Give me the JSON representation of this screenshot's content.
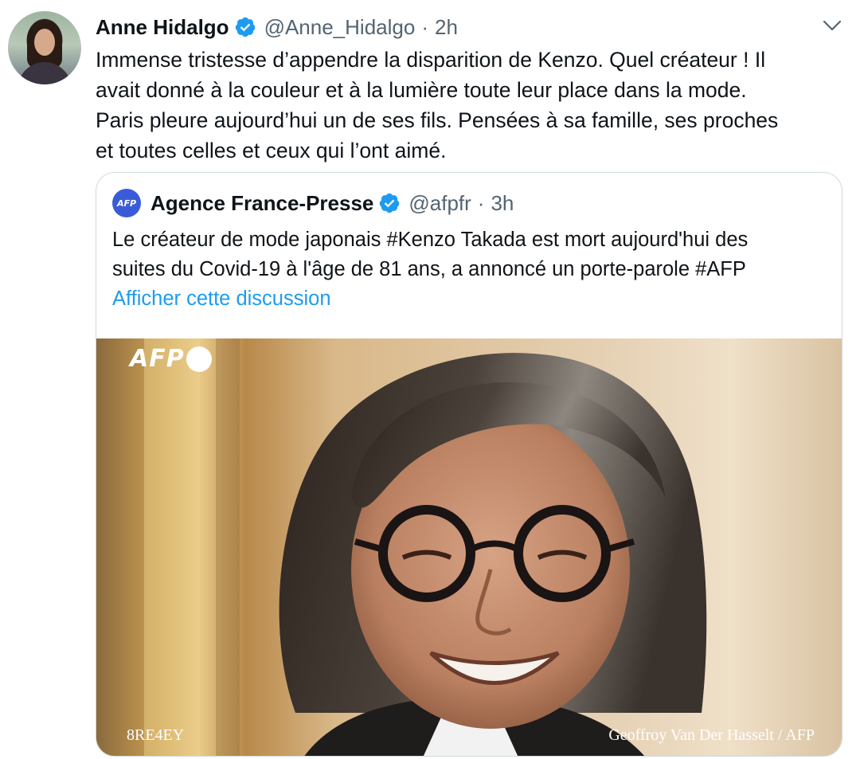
{
  "tweet": {
    "author_name": "Anne Hidalgo",
    "handle": "@Anne_Hidalgo",
    "separator": "·",
    "time": "2h",
    "text": "Immense tristesse d’appendre la disparition de Kenzo. Quel créateur ! Il\navait donné à la couleur et à la lumière toute leur place dans la mode.\nParis pleure aujourd’hui un de ses fils. Pensées à sa famille, ses proches\net toutes celles et ceux qui l’ont aimé.",
    "menu_icon": "chevron-down-icon",
    "verified_icon": "verified-badge-icon"
  },
  "quoted": {
    "avatar_text": "AFP",
    "author_name": "Agence France-Presse",
    "handle": "@afpfr",
    "separator": "·",
    "time": "3h",
    "text": "Le créateur de mode japonais #Kenzo Takada est mort aujourd'hui des\nsuites du Covid-19 à l'âge de 81 ans, a annoncé un porte-parole #AFP",
    "show_thread": "Afficher cette discussion",
    "verified_icon": "verified-badge-icon"
  },
  "photo": {
    "logo_text": "AFP",
    "photo_id": "8RE4EY",
    "credit": "Geoffroy Van Der Hasselt / AFP"
  },
  "colors": {
    "link": "#1d9bf0",
    "verified": "#1d9bf0",
    "secondary_text": "#536471",
    "border": "#cfd9de"
  }
}
